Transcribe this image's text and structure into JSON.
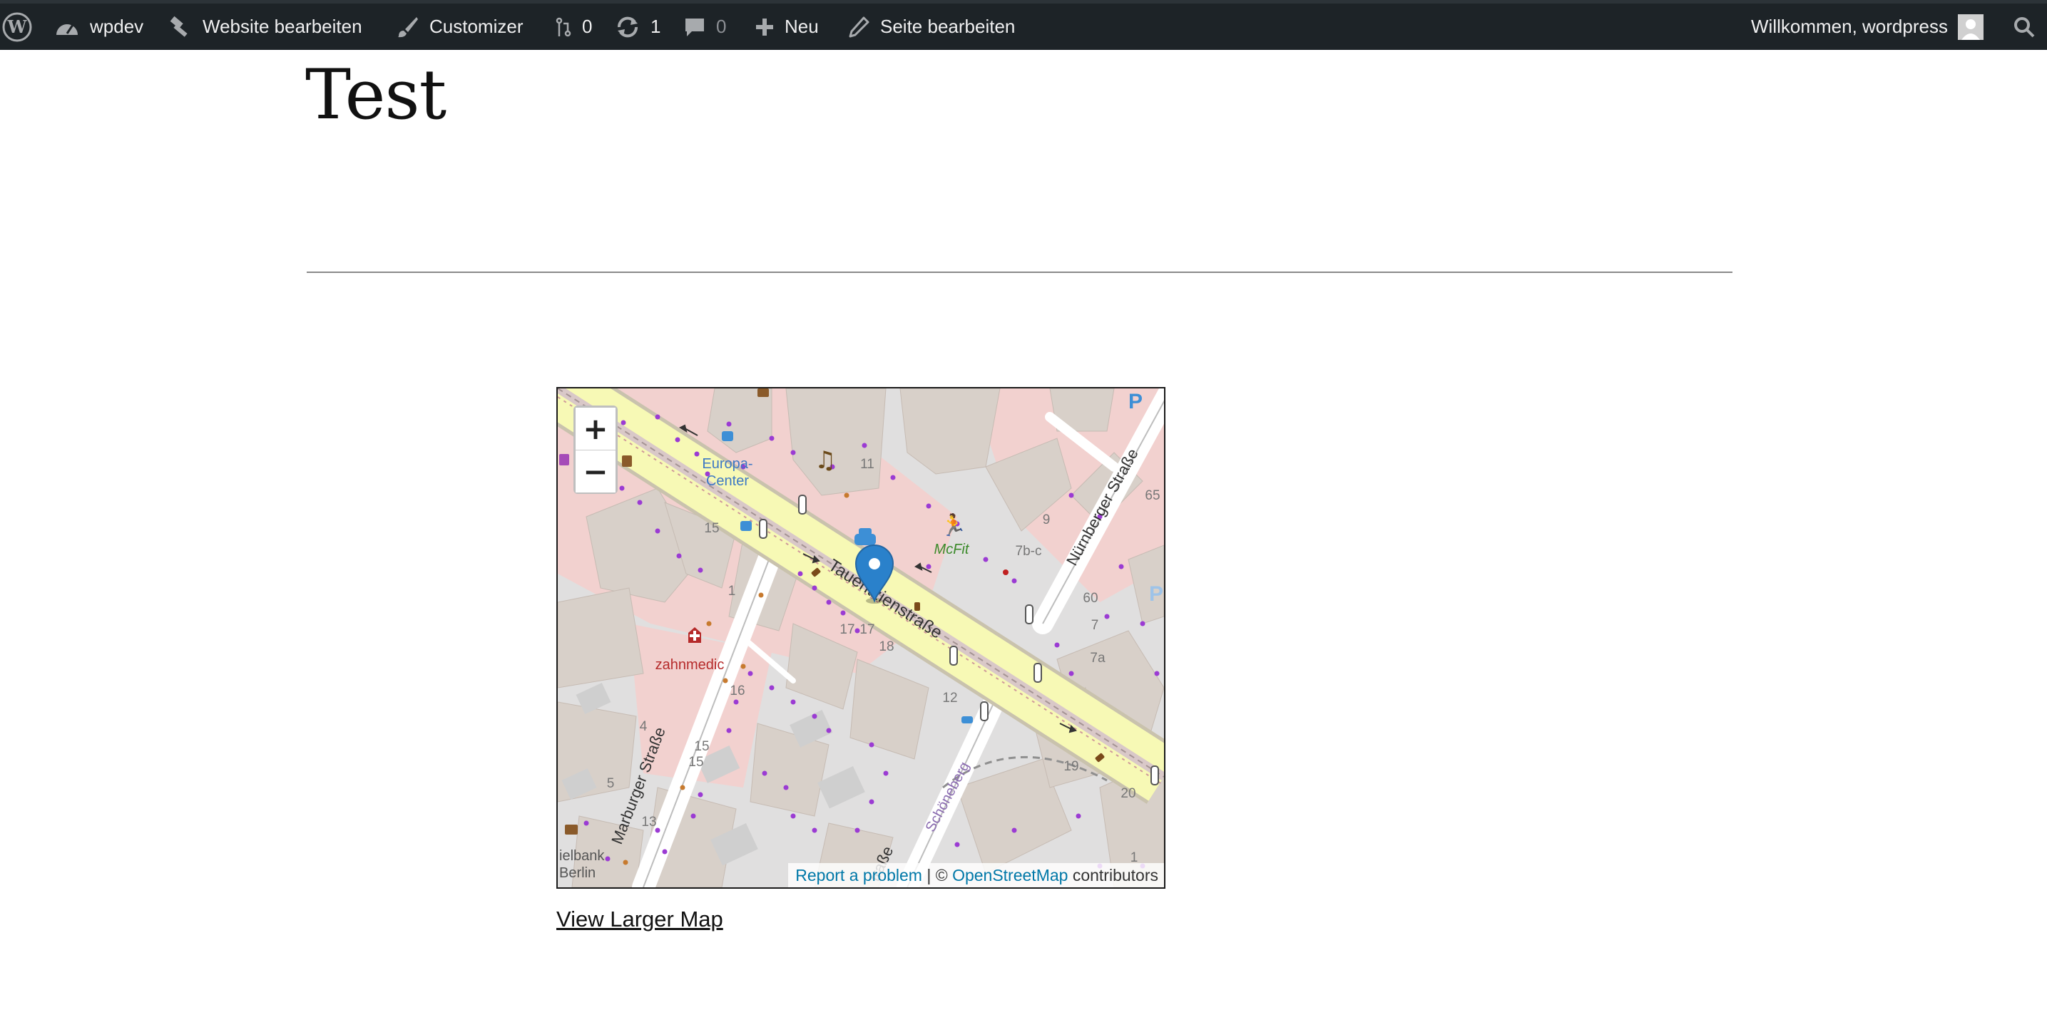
{
  "adminbar": {
    "wp_logo": "wordpress-logo-icon",
    "site": "wpdev",
    "edit_site": "Website bearbeiten",
    "customizer": "Customizer",
    "revisions_count": "0",
    "updates_count": "1",
    "comments_count": "0",
    "new_label": "Neu",
    "edit_page": "Seite bearbeiten",
    "welcome": "Willkommen, wordpress"
  },
  "page": {
    "title": "Test"
  },
  "map": {
    "zoom_in": "+",
    "zoom_out": "−",
    "attribution": {
      "report": "Report a problem",
      "separator": " | © ",
      "osm": "OpenStreetMap",
      "contributors": " contributors"
    },
    "labels": {
      "europa_center": "Europa-\nCenter",
      "europa_line1": "Europa-",
      "europa_line2": "Center",
      "mcfit": "McFit",
      "zahnmedic": "zahnmedic",
      "tauentzien": "Tauentzienstraße",
      "nuernberger": "Nürnberger Straße",
      "marburger": "Marburger Straße",
      "schoeneberg": "Schöneberg",
      "partial_strasse": "traße",
      "bank_line1": "ielbank",
      "bank_line2": "Berlin",
      "parking": "P"
    },
    "house_numbers": [
      "11",
      "9",
      "7b-c",
      "65",
      "15",
      "60",
      "7",
      "7a",
      "1",
      "17",
      "17",
      "18",
      "12",
      "16",
      "4",
      "15",
      "15",
      "5",
      "13",
      "19",
      "20",
      "1"
    ]
  },
  "link": {
    "view_larger": "View Larger Map"
  }
}
